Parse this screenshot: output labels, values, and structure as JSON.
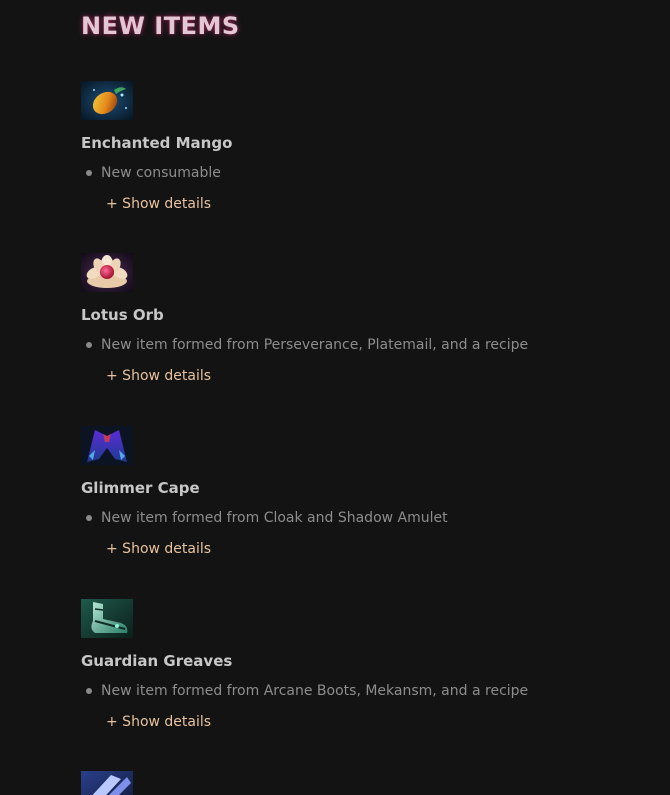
{
  "section": {
    "title": "NEW ITEMS"
  },
  "items": [
    {
      "name": "Enchanted Mango",
      "icon": "mango-icon",
      "description": "New consumable",
      "details_label": "+ Show details"
    },
    {
      "name": "Lotus Orb",
      "icon": "lotus-orb-icon",
      "description": "New item formed from Perseverance, Platemail, and a recipe",
      "details_label": "+ Show details"
    },
    {
      "name": "Glimmer Cape",
      "icon": "glimmer-cape-icon",
      "description": "New item formed from Cloak and Shadow Amulet",
      "details_label": "+ Show details"
    },
    {
      "name": "Guardian Greaves",
      "icon": "guardian-greaves-icon",
      "description": "New item formed from Arcane Boots, Mekansm, and a recipe",
      "details_label": "+ Show details"
    },
    {
      "icon": "item-icon"
    }
  ],
  "colors": {
    "background": "#131313",
    "title": "#e3c8d4",
    "title_glow": "#96285a",
    "item_name": "#c7c7c7",
    "description": "#8d8d8d",
    "link": "#e7c2a0"
  }
}
